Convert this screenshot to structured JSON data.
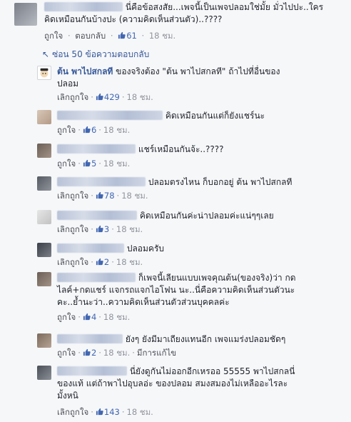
{
  "top_comment": {
    "name_visible": false,
    "text": "นี่คือข้อสงสัย...เพจนี้เป็นเพจปลอมใช่มั้ย มั่วไปปะ..ใคร คิดเหมือนกันบ้างปะ (ความคิดเห็นส่วนตัว)..????",
    "line1": "นี่คือข้อสงสัย...เพจนี้เป็นเพจปลอมใช่มั้ย มั่วไปปะ..ใคร",
    "line2": "คิดเหมือนกันบ้างปะ (ความคิดเห็นส่วนตัว)..????",
    "like_label": "ถูกใจ",
    "reply_label": "ตอบกลับ",
    "likes": "61",
    "time": "18 ชม."
  },
  "replies_toggle": {
    "label": "ซ่อน 50 ข้อความตอบกลับ"
  },
  "replies": [
    {
      "name": "ต้น พาไปสกลที",
      "line1": "ของจริงต้อง \"ต้น พาไปสกลที\" ถ้าไปที่อื่นของ",
      "line2": "ปลอม",
      "action_label": "เลิกถูกใจ",
      "likes": "429",
      "time": "18 ชม."
    },
    {
      "text": "คิดเหมือนกันแต่ก็ยังแชร์นะ",
      "action_label": "ถูกใจ",
      "likes": "6",
      "time": "18 ชม."
    },
    {
      "text": "แชร์เหมือนกันจ้ะ..????",
      "action_label": "ถูกใจ",
      "likes": "5",
      "time": "18 ชม."
    },
    {
      "text": "ปลอมตรงไหน ก็บอกอยู่ ต้น พาไปสกลที",
      "action_label": "เลิกถูกใจ",
      "likes": "78",
      "time": "18 ชม."
    },
    {
      "text": "คิดเหมือนกันค่ะน่าปลอมค่ะแน่ๆๆเลย",
      "action_label": "เลิกถูกใจ",
      "likes": "3",
      "time": "18 ชม."
    },
    {
      "text": "ปลอมครับ",
      "action_label": "เลิกถูกใจ",
      "likes": "2",
      "time": "18 ชม."
    },
    {
      "line1": "ก็เพจนี้เลียนแบบเพจคุณต้น(ของจริง)ว่า กด",
      "line2": "ไลค์+กดแชร์ แจกรถแจกไอโฟน นะ..นี่คือความคิดเห็นส่วนตัวนะ",
      "line3": "คะ..ย้ำนะว่า..ความคิดเห็นส่วนตัวส่วนบุคคลค่ะ",
      "action_label": "ถูกใจ",
      "likes": "4",
      "time": "18 ชม."
    },
    {
      "text": "ยังๆ ยังมีมาเถียงแทนอีก เพจแมร่งปลอมชัดๆ",
      "action_label": "ถูกใจ",
      "likes": "2",
      "time": "18 ชม.",
      "edited_label": "มีการแก้ไข"
    },
    {
      "line1": "นี่ยังดูกันไม่ออกอีกเหรออ 55555 พาไปสกลนี่",
      "line2": "ของแท้ แต่ถ้าพาไปอุบลอ่ะ ของปลอม สมงสมองไม่เหลืออะไรละ",
      "line3": "มั้งหนิ",
      "action_label": "เลิกถูกใจ",
      "likes": "143",
      "time": "18 ชม."
    }
  ],
  "icons": {
    "like": "thumbs-up-icon",
    "collapse": "collapse-arrow-icon"
  },
  "colors": {
    "link": "#365899",
    "like_blue": "#4267b2",
    "meta_gray": "#90949c",
    "background": "#f6f7f9"
  }
}
